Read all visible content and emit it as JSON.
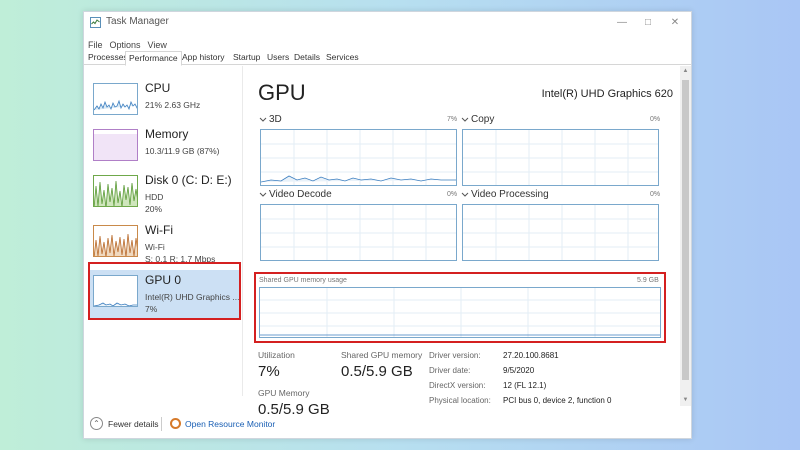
{
  "window": {
    "title": "Task Manager",
    "menu": [
      "File",
      "Options",
      "View"
    ],
    "tabs": [
      "Processes",
      "Performance",
      "App history",
      "Startup",
      "Users",
      "Details",
      "Services"
    ],
    "active_tab": "Performance"
  },
  "sidebar": {
    "items": [
      {
        "title": "CPU",
        "sub1": "21%  2.63 GHz",
        "sub2": ""
      },
      {
        "title": "Memory",
        "sub1": "10.3/11.9 GB (87%)",
        "sub2": ""
      },
      {
        "title": "Disk 0 (C: D: E:)",
        "sub1": "HDD",
        "sub2": "20%"
      },
      {
        "title": "Wi-Fi",
        "sub1": "Wi-Fi",
        "sub2": "S: 0.1  R: 1.7 Mbps"
      },
      {
        "title": "GPU 0",
        "sub1": "Intel(R) UHD Graphics ...",
        "sub2": "7%"
      }
    ],
    "selected": "GPU 0"
  },
  "main": {
    "title": "GPU",
    "gpu_name": "Intel(R) UHD Graphics 620",
    "graphs": [
      {
        "label": "3D",
        "pct": "7%"
      },
      {
        "label": "Copy",
        "pct": "0%"
      },
      {
        "label": "Video Decode",
        "pct": "0%"
      },
      {
        "label": "Video Processing",
        "pct": "0%"
      }
    ],
    "shared": {
      "label": "Shared GPU memory usage",
      "max": "5.9 GB"
    },
    "stats": {
      "utilization_label": "Utilization",
      "utilization_value": "7%",
      "shared_label": "Shared GPU memory",
      "shared_value": "0.5/5.9 GB",
      "gpu_memory_label": "GPU Memory",
      "gpu_memory_value": "0.5/5.9 GB"
    },
    "details": [
      {
        "key": "Driver version:",
        "value": "27.20.100.8681"
      },
      {
        "key": "Driver date:",
        "value": "9/5/2020"
      },
      {
        "key": "DirectX version:",
        "value": "12 (FL 12.1)"
      },
      {
        "key": "Physical location:",
        "value": "PCI bus 0, device 2, function 0"
      }
    ]
  },
  "footer": {
    "fewer_details": "Fewer details",
    "open_monitor": "Open Resource Monitor"
  },
  "colors": {
    "accent": "#1a5fb4",
    "graph_line": "#7aa8cc",
    "highlight": "#d42020",
    "selected_bg": "#cce0f4"
  }
}
